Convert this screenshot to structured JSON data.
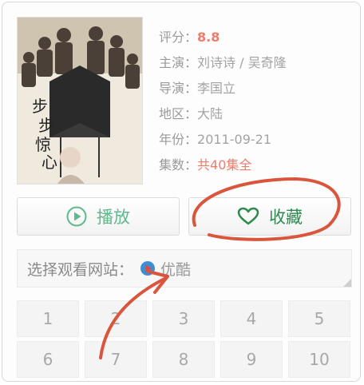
{
  "details": {
    "rating_label": "评分：",
    "rating_value": "8.8",
    "cast_label": "主演：",
    "cast_value": "刘诗诗 / 吴奇隆",
    "director_label": "导演：",
    "director_value": "李国立",
    "region_label": "地区：",
    "region_value": "大陆",
    "year_label": "年份：",
    "year_value": "2011-09-21",
    "episodes_label": "集数：",
    "episodes_value": "共40集全"
  },
  "actions": {
    "play_label": "播放",
    "favorite_label": "收藏"
  },
  "site_selector": {
    "label": "选择观看网站：",
    "selected_site": "优酷"
  },
  "episodes": [
    "1",
    "2",
    "3",
    "4",
    "5",
    "6",
    "7",
    "8",
    "9",
    "10"
  ],
  "icons": {
    "play": "play-circle-icon",
    "favorite": "heart-icon",
    "site_logo": "youku-logo-icon"
  },
  "colors": {
    "accent_green": "#5fb98c",
    "favorite_green": "#2f8a50",
    "highlight_red": "#ef7b6a",
    "annotation_red": "#d9553c"
  }
}
